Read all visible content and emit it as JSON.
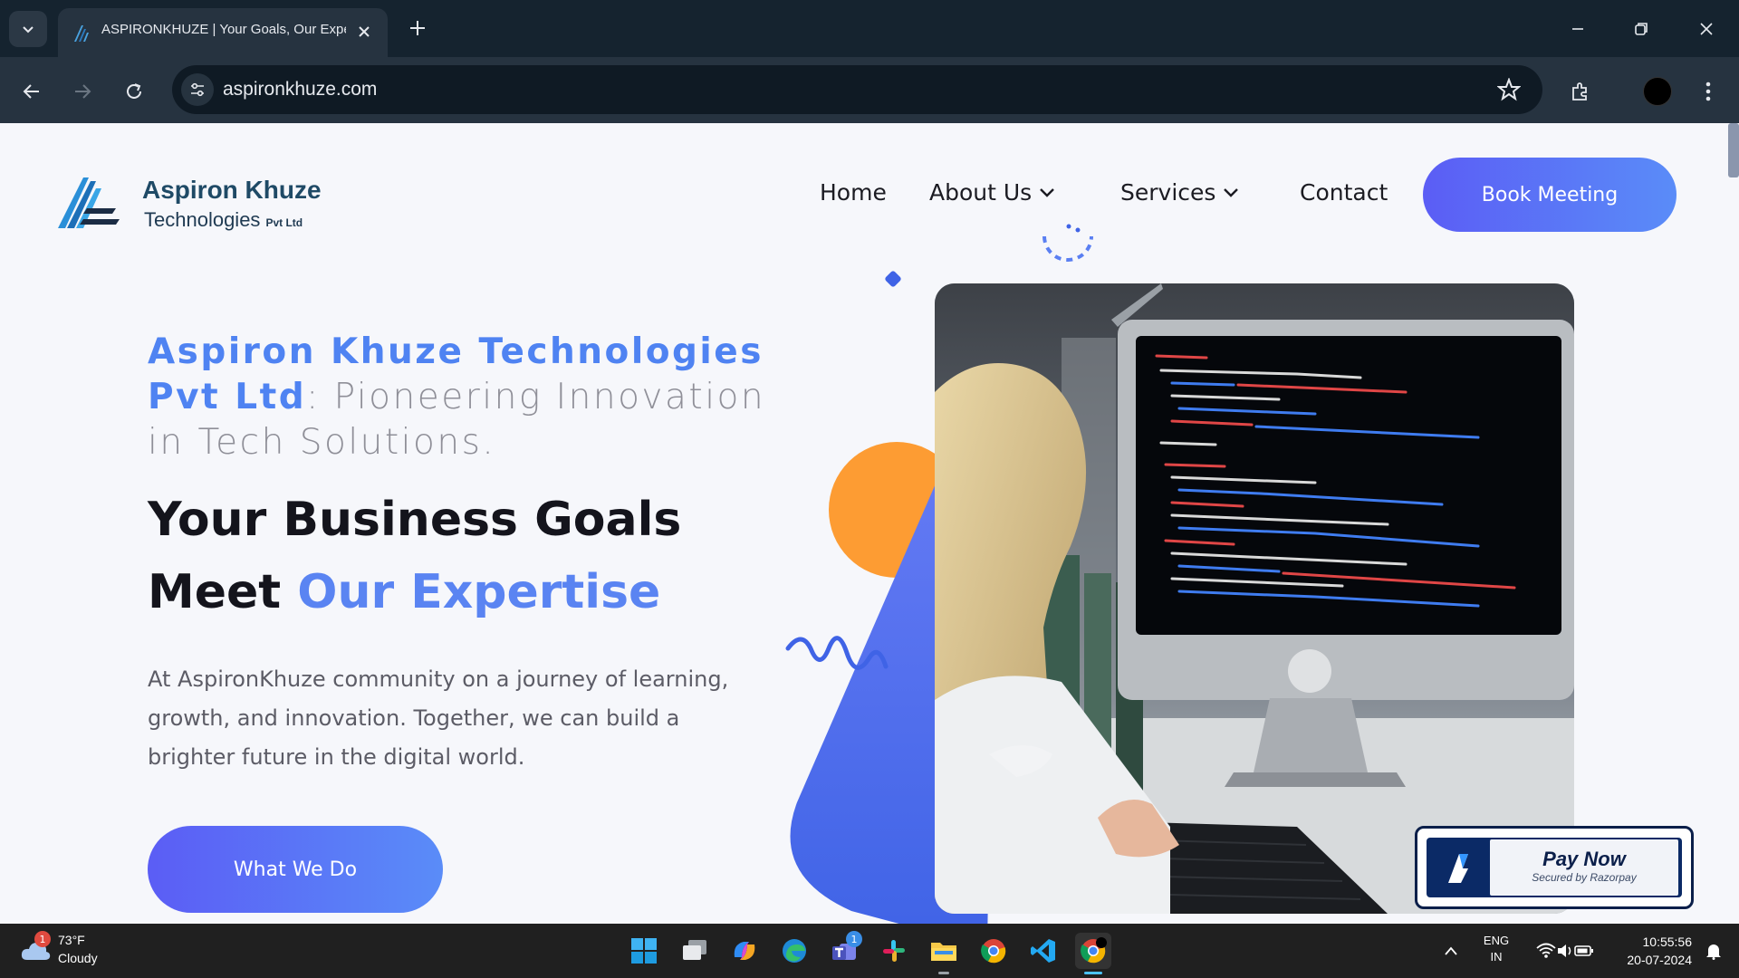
{
  "browser": {
    "tab_title": "ASPIRONKHUZE | Your Goals, Our Expertise",
    "url": "aspironkhuze.com"
  },
  "site": {
    "logo_name": "Aspiron Khuze",
    "logo_sub": "Technologies",
    "logo_pvt": "Pvt Ltd",
    "nav": [
      {
        "label": "Home",
        "has_dropdown": false
      },
      {
        "label": "About Us",
        "has_dropdown": true
      },
      {
        "label": "Services",
        "has_dropdown": true
      },
      {
        "label": "Contact",
        "has_dropdown": false
      }
    ],
    "cta_label": "Book Meeting",
    "hero": {
      "company_accent": "Aspiron Khuze Technologies Pvt Ltd",
      "company_rest": ": Pioneering Innovation in Tech Solutions.",
      "headline_line1": "Your Business Goals",
      "headline_line2_plain": "Meet ",
      "headline_line2_accent": "Our Expertise",
      "description": "At AspironKhuze community on a journey of learning, growth, and innovation. Together, we can build a brighter future in the digital world.",
      "button_label": "What We Do"
    },
    "pay_widget": {
      "title": "Pay Now",
      "subtitle": "Secured by Razorpay"
    },
    "colors": {
      "accent": "#5a84f2",
      "button_gradient_start": "#5b5df5",
      "button_gradient_end": "#5a8cf8",
      "deco_orange": "#fd9c33"
    }
  },
  "taskbar": {
    "weather_temp": "73°F",
    "weather_condition": "Cloudy",
    "weather_badge": "1",
    "apps": [
      "start-icon",
      "task-view-icon",
      "copilot-icon",
      "edge-icon",
      "teams-icon",
      "slack-icon",
      "file-explorer-icon",
      "chrome-icon",
      "vscode-icon",
      "chrome-active-icon"
    ],
    "teams_badge": "1",
    "lang_line1": "ENG",
    "lang_line2": "IN",
    "time": "10:55:56",
    "date": "20-07-2024"
  }
}
